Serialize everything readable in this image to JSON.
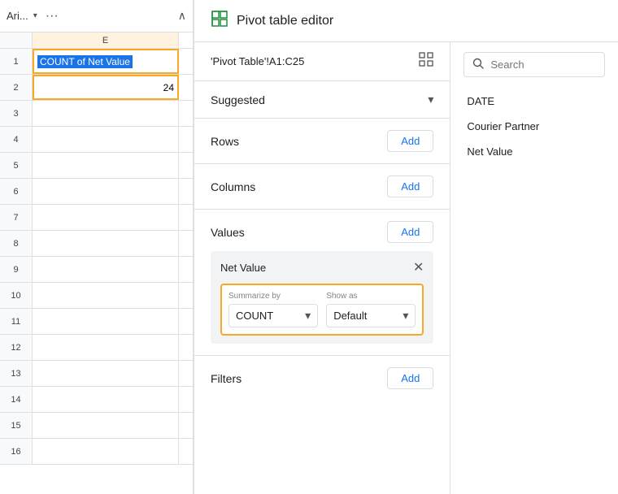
{
  "toolbar": {
    "font_name": "Ari...",
    "more_label": "···",
    "collapse_label": "∧"
  },
  "spreadsheet": {
    "col_header": "E",
    "rows": [
      {
        "row_num": "1",
        "cell_value": "COUNT of Net Value",
        "selected": true,
        "is_header": true
      },
      {
        "row_num": "2",
        "cell_value": "24",
        "selected": true,
        "align_right": true
      },
      {
        "row_num": "3",
        "cell_value": ""
      },
      {
        "row_num": "4",
        "cell_value": ""
      },
      {
        "row_num": "5",
        "cell_value": ""
      },
      {
        "row_num": "6",
        "cell_value": ""
      },
      {
        "row_num": "7",
        "cell_value": ""
      },
      {
        "row_num": "8",
        "cell_value": ""
      },
      {
        "row_num": "9",
        "cell_value": ""
      },
      {
        "row_num": "10",
        "cell_value": ""
      },
      {
        "row_num": "11",
        "cell_value": ""
      },
      {
        "row_num": "12",
        "cell_value": ""
      },
      {
        "row_num": "13",
        "cell_value": ""
      },
      {
        "row_num": "14",
        "cell_value": ""
      },
      {
        "row_num": "15",
        "cell_value": ""
      },
      {
        "row_num": "16",
        "cell_value": ""
      }
    ]
  },
  "pivot_editor": {
    "title": "Pivot table editor",
    "data_range": "'Pivot Table'!A1:C25",
    "suggested_label": "Suggested",
    "rows_label": "Rows",
    "columns_label": "Columns",
    "values_label": "Values",
    "filters_label": "Filters",
    "add_label": "Add",
    "net_value_card": {
      "title": "Net Value",
      "summarize_label": "Summarize by",
      "summarize_value": "COUNT",
      "show_as_label": "Show as",
      "show_as_value": "Default"
    }
  },
  "search_panel": {
    "placeholder": "Search",
    "fields": [
      {
        "name": "DATE"
      },
      {
        "name": "Courier Partner"
      },
      {
        "name": "Net Value"
      }
    ]
  },
  "icons": {
    "pivot_table": "▦",
    "grid": "▦",
    "search": "🔍",
    "close": "✕",
    "chevron_down": "▾",
    "chevron_up": "▴"
  }
}
